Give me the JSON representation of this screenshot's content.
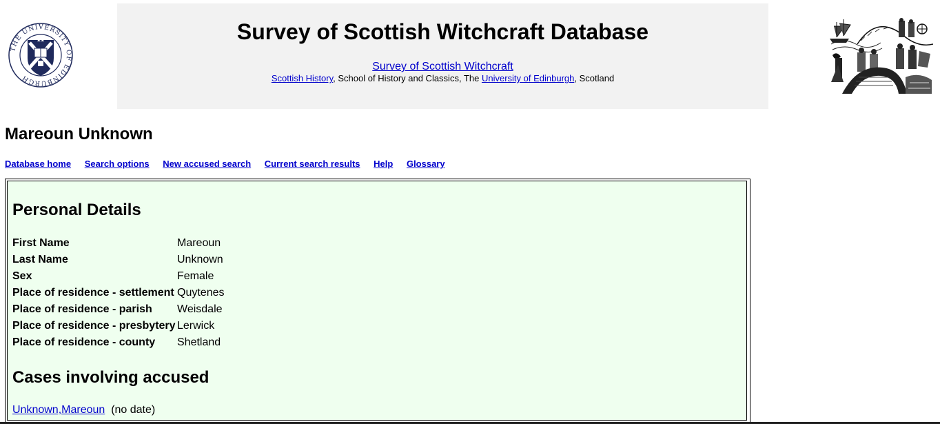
{
  "banner": {
    "site_title": "Survey of Scottish Witchcraft Database",
    "project_link": "Survey of Scottish Witchcraft",
    "affiliation": {
      "history_link": "Scottish History",
      "school_text": ", School of History and Classics, The ",
      "university_link": "University of Edinburgh",
      "country_text": ", Scotland"
    },
    "logo_text": "THE UNIVERSITY OF EDINBURGH"
  },
  "page_title": "Mareoun Unknown",
  "nav": {
    "items": [
      "Database home",
      "Search options",
      "New accused search",
      "Current search results",
      "Help",
      "Glossary"
    ]
  },
  "personal_details": {
    "heading": "Personal Details",
    "rows": [
      {
        "label": "First Name",
        "value": "Mareoun"
      },
      {
        "label": "Last Name",
        "value": "Unknown"
      },
      {
        "label": "Sex",
        "value": "Female"
      },
      {
        "label": "Place of residence - settlement",
        "value": "Quytenes"
      },
      {
        "label": "Place of residence - parish",
        "value": "Weisdale"
      },
      {
        "label": "Place of residence - presbytery",
        "value": "Lerwick"
      },
      {
        "label": "Place of residence - county",
        "value": "Shetland"
      }
    ]
  },
  "cases": {
    "heading": "Cases involving accused",
    "items": [
      {
        "link": "Unknown,Mareoun",
        "date": "(no date)"
      }
    ]
  },
  "colors": {
    "banner_background": "#f2f2f2",
    "record_background": "#efffef",
    "link": "#0000cc"
  }
}
